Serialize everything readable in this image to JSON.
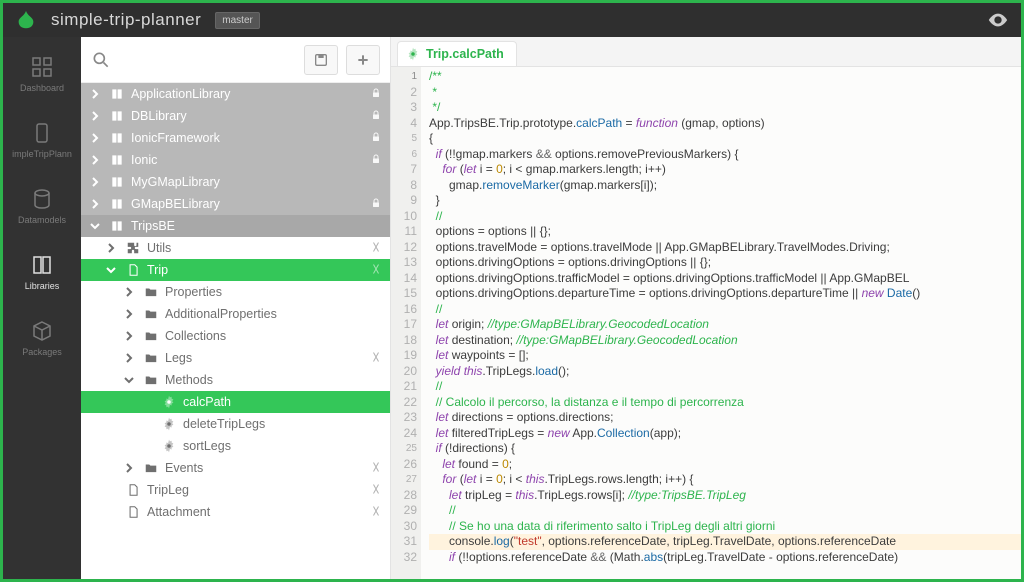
{
  "chrome": {
    "projectTitle": "simple-trip-planner",
    "branch": "master"
  },
  "rail": {
    "items": [
      {
        "id": "dashboard",
        "label": "Dashboard",
        "icon": "grid-icon",
        "active": false
      },
      {
        "id": "tripplan",
        "label": "impleTripPlann",
        "icon": "device-icon",
        "active": false
      },
      {
        "id": "datamodels",
        "label": "Datamodels",
        "icon": "database-icon",
        "active": false
      },
      {
        "id": "libraries",
        "label": "Libraries",
        "icon": "book-icon",
        "active": true
      },
      {
        "id": "packages",
        "label": "Packages",
        "icon": "box-icon",
        "active": false
      }
    ]
  },
  "sidebar": {
    "libraries": [
      {
        "label": "ApplicationLibrary",
        "locked": true,
        "open": false
      },
      {
        "label": "DBLibrary",
        "locked": true,
        "open": false
      },
      {
        "label": "IonicFramework",
        "locked": true,
        "open": false
      },
      {
        "label": "Ionic",
        "locked": true,
        "open": false
      },
      {
        "label": "MyGMapLibrary",
        "locked": false,
        "open": false
      },
      {
        "label": "GMapBELibrary",
        "locked": true,
        "open": false
      },
      {
        "label": "TripsBE",
        "locked": false,
        "open": true
      }
    ],
    "tripsBE": {
      "utils": {
        "label": "Utils",
        "misc": true
      },
      "trip": {
        "label": "Trip",
        "misc": true,
        "selected": true
      },
      "tripLeg": {
        "label": "TripLeg"
      },
      "attachment": {
        "label": "Attachment"
      },
      "tripChildren": {
        "properties": {
          "label": "Properties"
        },
        "additionalProperties": {
          "label": "AdditionalProperties"
        },
        "collections": {
          "label": "Collections"
        },
        "legs": {
          "label": "Legs",
          "misc": true
        },
        "methods": {
          "label": "Methods",
          "open": true
        },
        "events": {
          "label": "Events",
          "misc": true
        }
      },
      "methods": {
        "calcPath": {
          "label": "calcPath",
          "selected": true
        },
        "deleteTripLegs": {
          "label": "deleteTripLegs"
        },
        "sortLegs": {
          "label": "sortLegs"
        }
      }
    }
  },
  "editor": {
    "tab": {
      "label": "Trip.calcPath"
    },
    "lines": [
      {
        "n": 1,
        "html": "<span class='c-cm'>/**</span>",
        "fold": true
      },
      {
        "n": 2,
        "html": "<span class='c-cm'> *</span>"
      },
      {
        "n": 3,
        "html": "<span class='c-cm'> */</span>"
      },
      {
        "n": 4,
        "html": "App.TripsBE.Trip.prototype.<span class='c-fn'>calcPath</span> = <span class='c-kw'>function</span> (gmap, options)"
      },
      {
        "n": 5,
        "html": "{",
        "fold": true
      },
      {
        "n": 6,
        "html": "  <span class='c-kw'>if</span> (!!gmap.markers <span class='c-op'>&amp;&amp;</span> options.removePreviousMarkers) {",
        "fold": true
      },
      {
        "n": 7,
        "html": "    <span class='c-kw'>for</span> (<span class='c-kw'>let</span> i = <span class='c-nm'>0</span>; i &lt; gmap.markers.length; i++)"
      },
      {
        "n": 8,
        "html": "      gmap.<span class='c-fn'>removeMarker</span>(gmap.markers[i]);"
      },
      {
        "n": 9,
        "html": "  }"
      },
      {
        "n": 10,
        "html": "  <span class='c-cm'>//</span>"
      },
      {
        "n": 11,
        "html": "  options = options || {};"
      },
      {
        "n": 12,
        "html": "  options.travelMode = options.travelMode || App.GMapBELibrary.TravelModes.Driving;"
      },
      {
        "n": 13,
        "html": "  options.drivingOptions = options.drivingOptions || {};"
      },
      {
        "n": 14,
        "html": "  options.drivingOptions.trafficModel = options.drivingOptions.trafficModel || App.GMapBEL"
      },
      {
        "n": 15,
        "html": "  options.drivingOptions.departureTime = options.drivingOptions.departureTime || <span class='c-kw'>new</span> <span class='c-fn'>Date</span>()"
      },
      {
        "n": 16,
        "html": "  <span class='c-cm'>//</span>"
      },
      {
        "n": 17,
        "html": "  <span class='c-kw'>let</span> origin; <span class='c-ty'>//type:GMapBELibrary.GeocodedLocation</span>"
      },
      {
        "n": 18,
        "html": "  <span class='c-kw'>let</span> destination; <span class='c-ty'>//type:GMapBELibrary.GeocodedLocation</span>"
      },
      {
        "n": 19,
        "html": "  <span class='c-kw'>let</span> waypoints = [];"
      },
      {
        "n": 20,
        "html": "  <span class='c-kw'>yield</span> <span class='c-kw'>this</span>.TripLegs.<span class='c-fn'>load</span>();"
      },
      {
        "n": 21,
        "html": "  <span class='c-cm'>//</span>"
      },
      {
        "n": 22,
        "html": "  <span class='c-cm'>// Calcolo il percorso, la distanza e il tempo di percorrenza</span>"
      },
      {
        "n": 23,
        "html": "  <span class='c-kw'>let</span> directions = options.directions;"
      },
      {
        "n": 24,
        "html": "  <span class='c-kw'>let</span> filteredTripLegs = <span class='c-kw'>new</span> App.<span class='c-fn'>Collection</span>(app);"
      },
      {
        "n": 25,
        "html": "  <span class='c-kw'>if</span> (!directions) {",
        "fold": true
      },
      {
        "n": 26,
        "html": "    <span class='c-kw'>let</span> found = <span class='c-nm'>0</span>;"
      },
      {
        "n": 27,
        "html": "    <span class='c-kw'>for</span> (<span class='c-kw'>let</span> i = <span class='c-nm'>0</span>; i &lt; <span class='c-kw'>this</span>.TripLegs.rows.length; i++) {",
        "fold": true
      },
      {
        "n": 28,
        "html": "      <span class='c-kw'>let</span> tripLeg = <span class='c-kw'>this</span>.TripLegs.rows[i]; <span class='c-ty'>//type:TripsBE.TripLeg</span>"
      },
      {
        "n": 29,
        "html": "      <span class='c-cm'>//</span>"
      },
      {
        "n": 30,
        "html": "      <span class='c-cm'>// Se ho una data di riferimento salto i TripLeg degli altri giorni</span>"
      },
      {
        "n": 31,
        "html": "      console.<span class='c-fn'>log</span>(<span class='c-st'>\"test\"</span>, options.referenceDate, tripLeg.TravelDate, options.referenceDate",
        "ov": true
      },
      {
        "n": 32,
        "html": "      <span class='c-kw'>if</span> (!!options.referenceDate <span class='c-op'>&amp;&amp;</span> (Math.<span class='c-fn'>abs</span>(tripLeg.TravelDate - options.referenceDate) "
      }
    ]
  }
}
